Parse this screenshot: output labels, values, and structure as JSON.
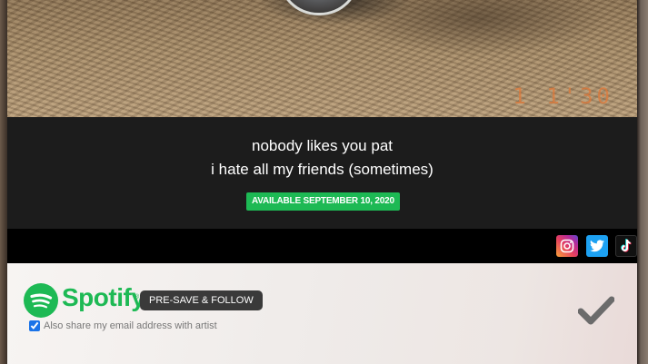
{
  "release": {
    "artist": "nobody likes you pat",
    "title": "i hate all my friends (sometimes)",
    "availability": "AVAILABLE SEPTEMBER 10, 2020"
  },
  "photo": {
    "datestamp": "1  1'30"
  },
  "social": {
    "icons": [
      "instagram-icon",
      "twitter-icon",
      "tiktok-icon"
    ]
  },
  "presave": {
    "brand": "Spotify",
    "button_label": "PRE-SAVE & FOLLOW",
    "share_label": "Also share my email address with artist",
    "share_checked": true
  },
  "colors": {
    "spotify_green": "#1db954",
    "twitter_blue": "#1da1f2",
    "badge_green": "#1db954"
  }
}
